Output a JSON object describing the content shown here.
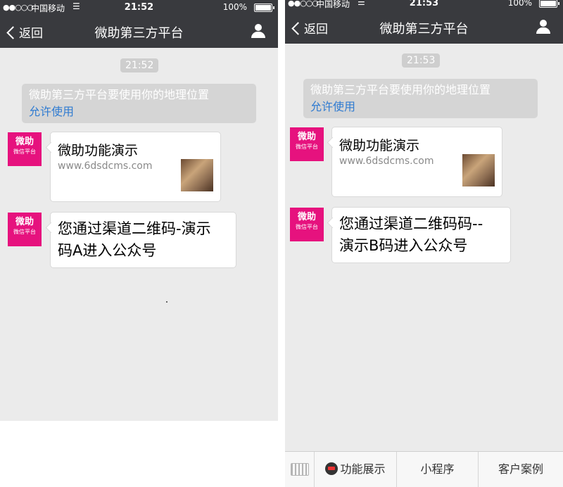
{
  "status": {
    "carrier": "中国移动",
    "battery": "100%",
    "signal_dots": "●●○○○",
    "left_time": "21:52",
    "right_time": "21:53"
  },
  "nav": {
    "back_label": "返回",
    "title": "微助第三方平台"
  },
  "avatar": {
    "big": "微助",
    "small": "微信平台"
  },
  "system_message": {
    "text": "微助第三方平台要使用你的地理位置",
    "link": "允许使用"
  },
  "card": {
    "title": "微助功能演示",
    "url": "www.6dsdcms.com"
  },
  "left": {
    "timestamp": "21:52",
    "message_line1": "您通过渠道二维码-演示",
    "message_line2": "码A进入公众号"
  },
  "right": {
    "timestamp": "21:53",
    "message_line1": "您通过渠道二维码码--",
    "message_line2": "演示B码进入公众号"
  },
  "bottom_menu": {
    "item1": "功能展示",
    "item2": "小程序",
    "item3": "客户案例"
  }
}
